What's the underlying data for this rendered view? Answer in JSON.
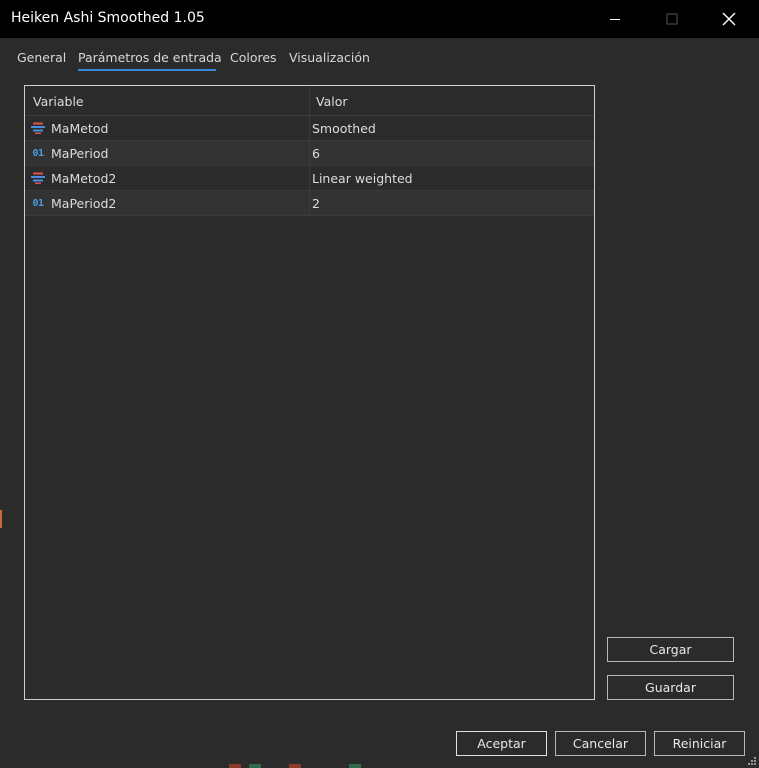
{
  "window": {
    "title": "Heiken Ashi Smoothed 1.05",
    "controls": [
      "minimize-icon",
      "maximize-icon",
      "close-icon"
    ]
  },
  "tabs": [
    {
      "label": "General",
      "active": false
    },
    {
      "label": "Parámetros de entrada",
      "active": true
    },
    {
      "label": "Colores",
      "active": false
    },
    {
      "label": "Visualización",
      "active": false
    }
  ],
  "table": {
    "headers": {
      "variable": "Variable",
      "value": "Valor"
    },
    "rows": [
      {
        "icon": "enum-icon",
        "name": "MaMetod",
        "value": "Smoothed"
      },
      {
        "icon": "integer-icon",
        "icon_text": "01",
        "name": "MaPeriod",
        "value": "6"
      },
      {
        "icon": "enum-icon",
        "name": "MaMetod2",
        "value": "Linear weighted"
      },
      {
        "icon": "integer-icon",
        "icon_text": "01",
        "name": "MaPeriod2",
        "value": "2"
      }
    ]
  },
  "side_buttons": {
    "load": "Cargar",
    "save": "Guardar"
  },
  "footer_buttons": {
    "accept": "Aceptar",
    "cancel": "Cancelar",
    "reset": "Reiniciar"
  },
  "colors": {
    "accent": "#3a86d8",
    "background": "#2b2b2b",
    "titlebar": "#000000"
  }
}
